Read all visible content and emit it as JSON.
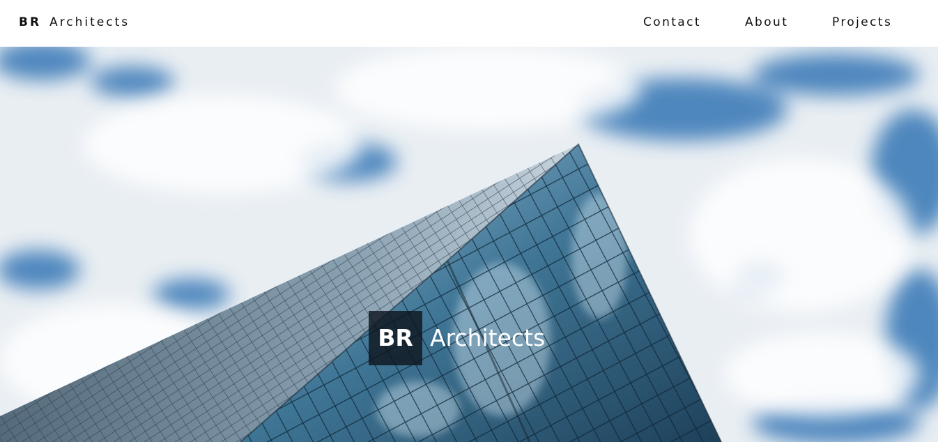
{
  "header": {
    "brand_initials": "BR",
    "brand_name": "Architects"
  },
  "nav": {
    "items": [
      {
        "label": "Contact"
      },
      {
        "label": "About"
      },
      {
        "label": "Projects"
      }
    ]
  },
  "hero": {
    "image_description_icon": "building-sky-photo",
    "title_initials": "BR",
    "title_name": "Architects"
  },
  "colors": {
    "sky_blue": "#3f7fbf",
    "cloud_white": "#f4f6f8",
    "glass_dark": "#1f3f58",
    "glass_light": "#7fb0cc",
    "title_box": "#0f161e"
  }
}
